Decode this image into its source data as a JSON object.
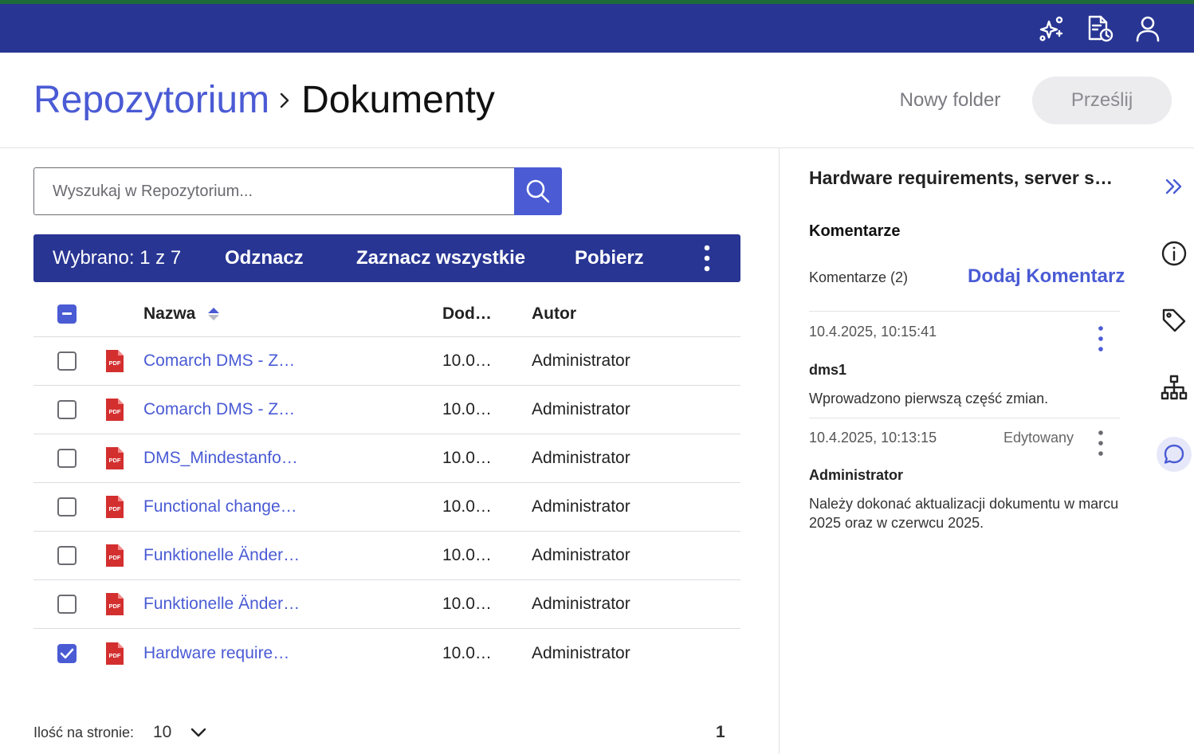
{
  "topbar": {
    "icons": [
      "ai-sparkles-icon",
      "document-history-icon",
      "user-account-icon"
    ]
  },
  "header": {
    "breadcrumb_root": "Repozytorium",
    "breadcrumb_current": "Dokumenty",
    "new_folder_label": "Nowy folder",
    "upload_label": "Prześlij"
  },
  "search": {
    "placeholder": "Wyszukaj w Repozytorium...",
    "value": ""
  },
  "selection_bar": {
    "selected_text": "Wybrano: 1 z 7",
    "deselect_label": "Odznacz",
    "select_all_label": "Zaznacz wszystkie",
    "download_label": "Pobierz"
  },
  "table": {
    "columns": {
      "name": "Nazwa",
      "date": "Dod…",
      "author": "Autor"
    },
    "sort": "ascending",
    "rows": [
      {
        "name": "Comarch DMS - Z…",
        "date": "10.0…",
        "author": "Administrator",
        "checked": false,
        "file_type": "PDF"
      },
      {
        "name": "Comarch DMS - Z…",
        "date": "10.0…",
        "author": "Administrator",
        "checked": false,
        "file_type": "PDF"
      },
      {
        "name": "DMS_Mindestanfo…",
        "date": "10.0…",
        "author": "Administrator",
        "checked": false,
        "file_type": "PDF"
      },
      {
        "name": "Functional change…",
        "date": "10.0…",
        "author": "Administrator",
        "checked": false,
        "file_type": "PDF"
      },
      {
        "name": "Funktionelle Änder…",
        "date": "10.0…",
        "author": "Administrator",
        "checked": false,
        "file_type": "PDF"
      },
      {
        "name": "Funktionelle Änder…",
        "date": "10.0…",
        "author": "Administrator",
        "checked": false,
        "file_type": "PDF"
      },
      {
        "name": "Hardware require…",
        "date": "10.0…",
        "author": "Administrator",
        "checked": true,
        "file_type": "PDF"
      }
    ]
  },
  "pagination": {
    "per_page_label": "Ilość na stronie:",
    "per_page_value": "10",
    "current_page": "1"
  },
  "side_panel": {
    "doc_title": "Hardware requirements, server so…",
    "section_title": "Komentarze",
    "comments_count_label": "Komentarze (2)",
    "add_comment_label": "Dodaj Komentarz",
    "comments": [
      {
        "timestamp": "10.4.2025, 10:15:41",
        "edited": "",
        "author": "dms1",
        "text": "Wprowadzono pierwszą część zmian."
      },
      {
        "timestamp": "10.4.2025, 10:13:15",
        "edited": "Edytowany",
        "author": "Administrator",
        "text": "Należy dokonać aktualizacji dokumentu w marcu 2025 oraz w czerwcu 2025."
      }
    ]
  },
  "rail": {
    "icons": [
      "collapse-panel-icon",
      "info-icon",
      "tag-icon",
      "hierarchy-icon",
      "comments-icon"
    ],
    "active": "comments-icon"
  },
  "colors": {
    "topbar": "#283593",
    "accent": "#4a5bd4",
    "pdf_red": "#d32f2f",
    "top_strip": "#1e6b3a"
  }
}
